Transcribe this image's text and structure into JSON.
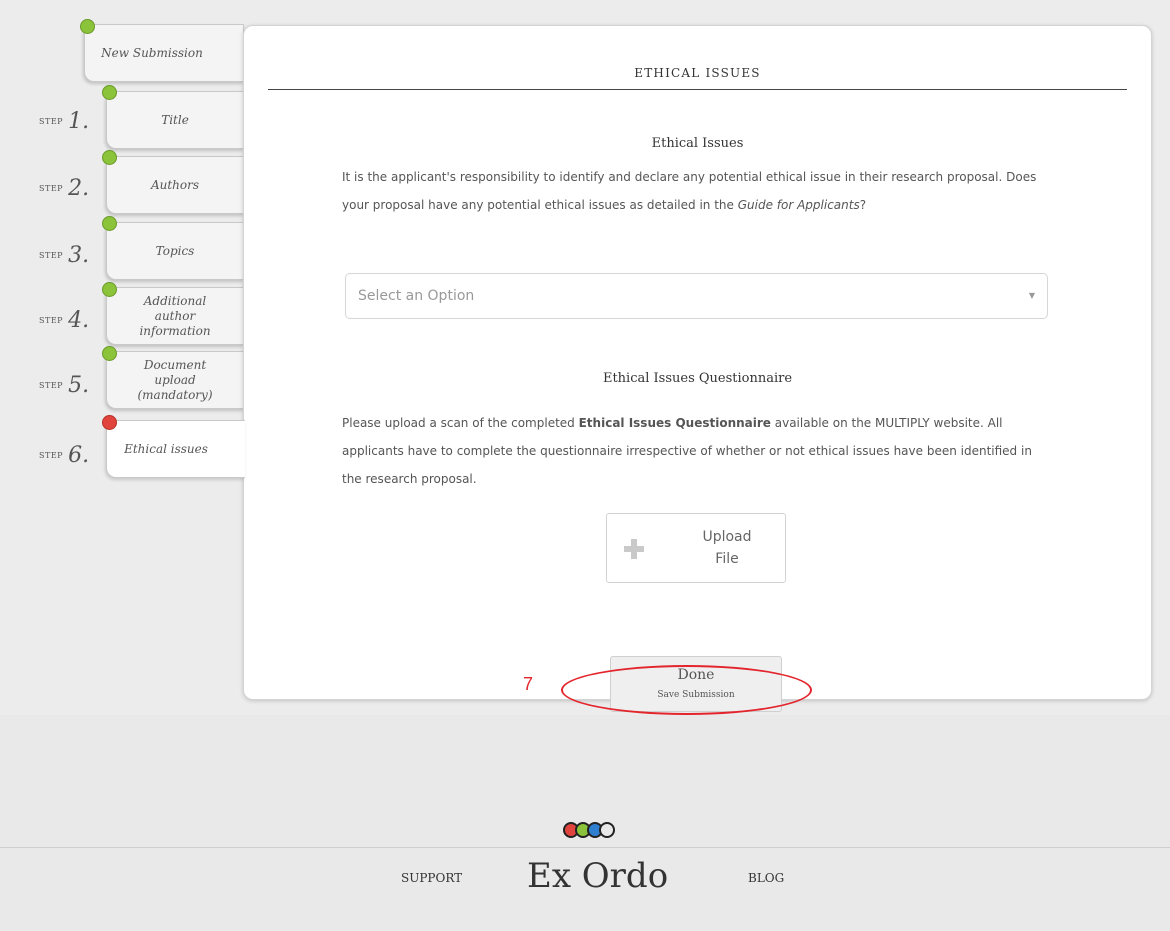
{
  "steps": [
    {
      "step_word": "",
      "number": "",
      "label": "New Submission",
      "status": "complete"
    },
    {
      "step_word": "STEP",
      "number": "1.",
      "label": "Title",
      "status": "complete"
    },
    {
      "step_word": "STEP",
      "number": "2.",
      "label": "Authors",
      "status": "complete"
    },
    {
      "step_word": "STEP",
      "number": "3.",
      "label": "Topics",
      "status": "complete"
    },
    {
      "step_word": "STEP",
      "number": "4.",
      "label": "Additional author information",
      "status": "complete"
    },
    {
      "step_word": "STEP",
      "number": "5.",
      "label": "Document upload (mandatory)",
      "status": "complete"
    },
    {
      "step_word": "STEP",
      "number": "6.",
      "label": "Ethical issues",
      "status": "incomplete"
    }
  ],
  "panel": {
    "title": "ETHICAL ISSUES",
    "ethical": {
      "heading": "Ethical Issues",
      "text_1": "It is the applicant's responsibility to identify and declare any potential ethical issue in their research proposal. Does your proposal have any potential ethical issues as detailed in the ",
      "guide_link": "Guide for Applicants",
      "text_2": "?",
      "select_placeholder": "Select an Option"
    },
    "questionnaire": {
      "heading": "Ethical Issues Questionnaire",
      "text_1": "Please upload a scan of the completed ",
      "bold": "Ethical Issues Questionnaire",
      "text_2": " available on the MULTIPLY website. All applicants have to complete the questionnaire irrespective of whether or not ethical issues have been identified in the research proposal.",
      "upload_line1": "Upload",
      "upload_line2": "File"
    },
    "done": {
      "label": "Done",
      "sublabel": "Save Submission"
    }
  },
  "callout": {
    "number": "7"
  },
  "footer": {
    "support": "SUPPORT",
    "brand": "Ex Ordo",
    "blog": "BLOG"
  },
  "colors": {
    "complete": "#8bc33a",
    "incomplete": "#e0443c",
    "annotation": "#e3262d"
  },
  "icons": {
    "upload": "plus-icon",
    "select_caret": "caret-down-icon"
  }
}
